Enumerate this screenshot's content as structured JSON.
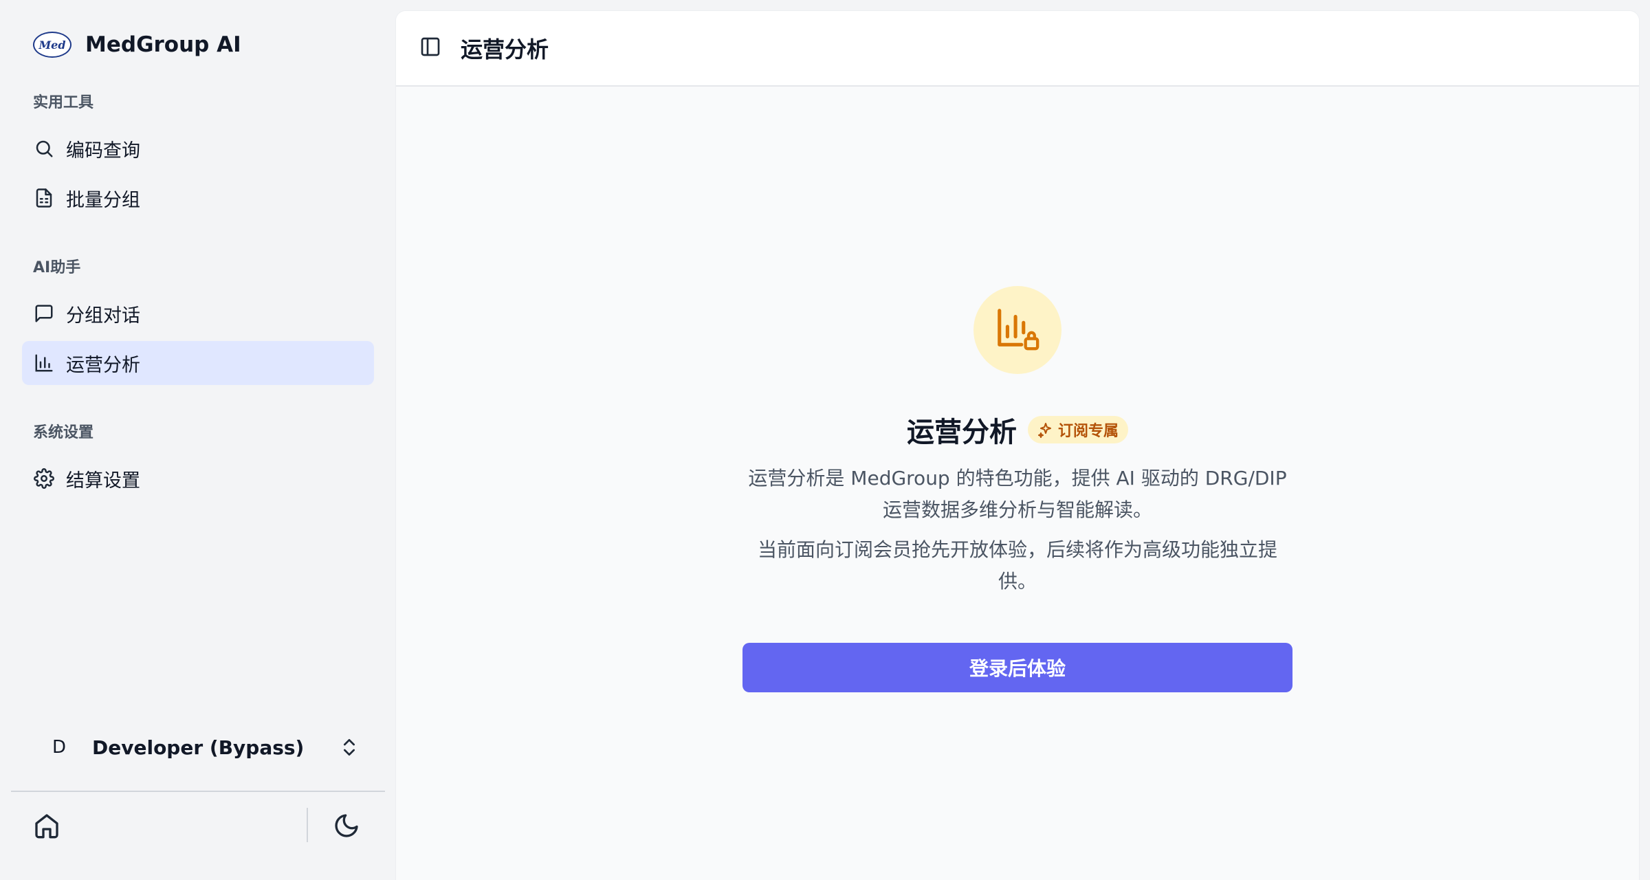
{
  "brand": {
    "logo_text": "Med",
    "name": "MedGroup AI"
  },
  "sidebar": {
    "sections": [
      {
        "label": "实用工具",
        "items": [
          {
            "label": "编码查询",
            "icon": "search-icon"
          },
          {
            "label": "批量分组",
            "icon": "file-spreadsheet-icon"
          }
        ]
      },
      {
        "label": "AI助手",
        "items": [
          {
            "label": "分组对话",
            "icon": "message-square-icon"
          },
          {
            "label": "运营分析",
            "icon": "bar-chart-icon",
            "active": true
          }
        ]
      },
      {
        "label": "系统设置",
        "items": [
          {
            "label": "结算设置",
            "icon": "gear-icon"
          }
        ]
      }
    ],
    "user": {
      "initial": "D",
      "name": "Developer (Bypass)"
    },
    "footer": {
      "home_icon": "home-icon",
      "theme_icon": "moon-icon"
    }
  },
  "header": {
    "title": "运营分析"
  },
  "promo": {
    "title": "运营分析",
    "badge": "订阅专属",
    "description_1": "运营分析是 MedGroup 的特色功能，提供 AI 驱动的 DRG/DIP 运营数据多维分析与智能解读。",
    "description_2": "当前面向订阅会员抢先开放体验，后续将作为高级功能独立提供。",
    "cta": "登录后体验"
  },
  "colors": {
    "accent": "#6366f1",
    "active_bg": "#e0e7ff",
    "badge_bg": "#fef3c7",
    "badge_text": "#b45309",
    "icon_orange": "#d97706"
  }
}
